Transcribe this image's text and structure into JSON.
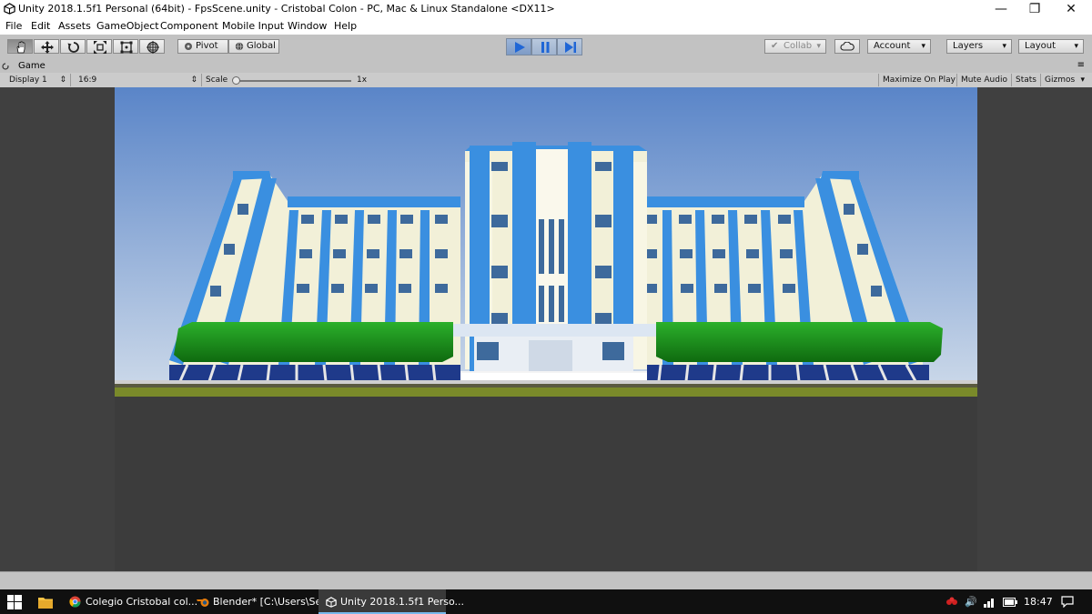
{
  "window": {
    "title": "Unity 2018.1.5f1 Personal (64bit) - FpsScene.unity - Cristobal Colon - PC, Mac & Linux Standalone <DX11>",
    "minimize": "—",
    "maximize": "❐",
    "close": "✕"
  },
  "menu": [
    "File",
    "Edit",
    "Assets",
    "GameObject",
    "Component",
    "Mobile Input",
    "Window",
    "Help"
  ],
  "toolbar": {
    "pivot_label": "Pivot",
    "global_label": "Global",
    "collab_label": "Collab",
    "account_label": "Account",
    "layers_label": "Layers",
    "layout_label": "Layout"
  },
  "game_tab": {
    "label": "Game",
    "display": "Display 1",
    "aspect": "16:9",
    "scale_label": "Scale",
    "scale_value": "1x",
    "maximize_on_play": "Maximize On Play",
    "mute_audio": "Mute Audio",
    "stats": "Stats",
    "gizmos": "Gizmos"
  },
  "taskbar": {
    "items": [
      {
        "label": "Colegio Cristobal col..."
      },
      {
        "label": "Blender* [C:\\Users\\Se..."
      },
      {
        "label": "Unity 2018.1.5f1 Perso..."
      }
    ],
    "time": "18:47"
  },
  "colors": {
    "accent": "#3a7fd5",
    "building_blue": "#3a8fe0",
    "building_cream": "#f2f0d8",
    "hedge_green": "#1a8a1a",
    "sky_top": "#5a85c8",
    "sky_bottom": "#c8d6e8"
  }
}
